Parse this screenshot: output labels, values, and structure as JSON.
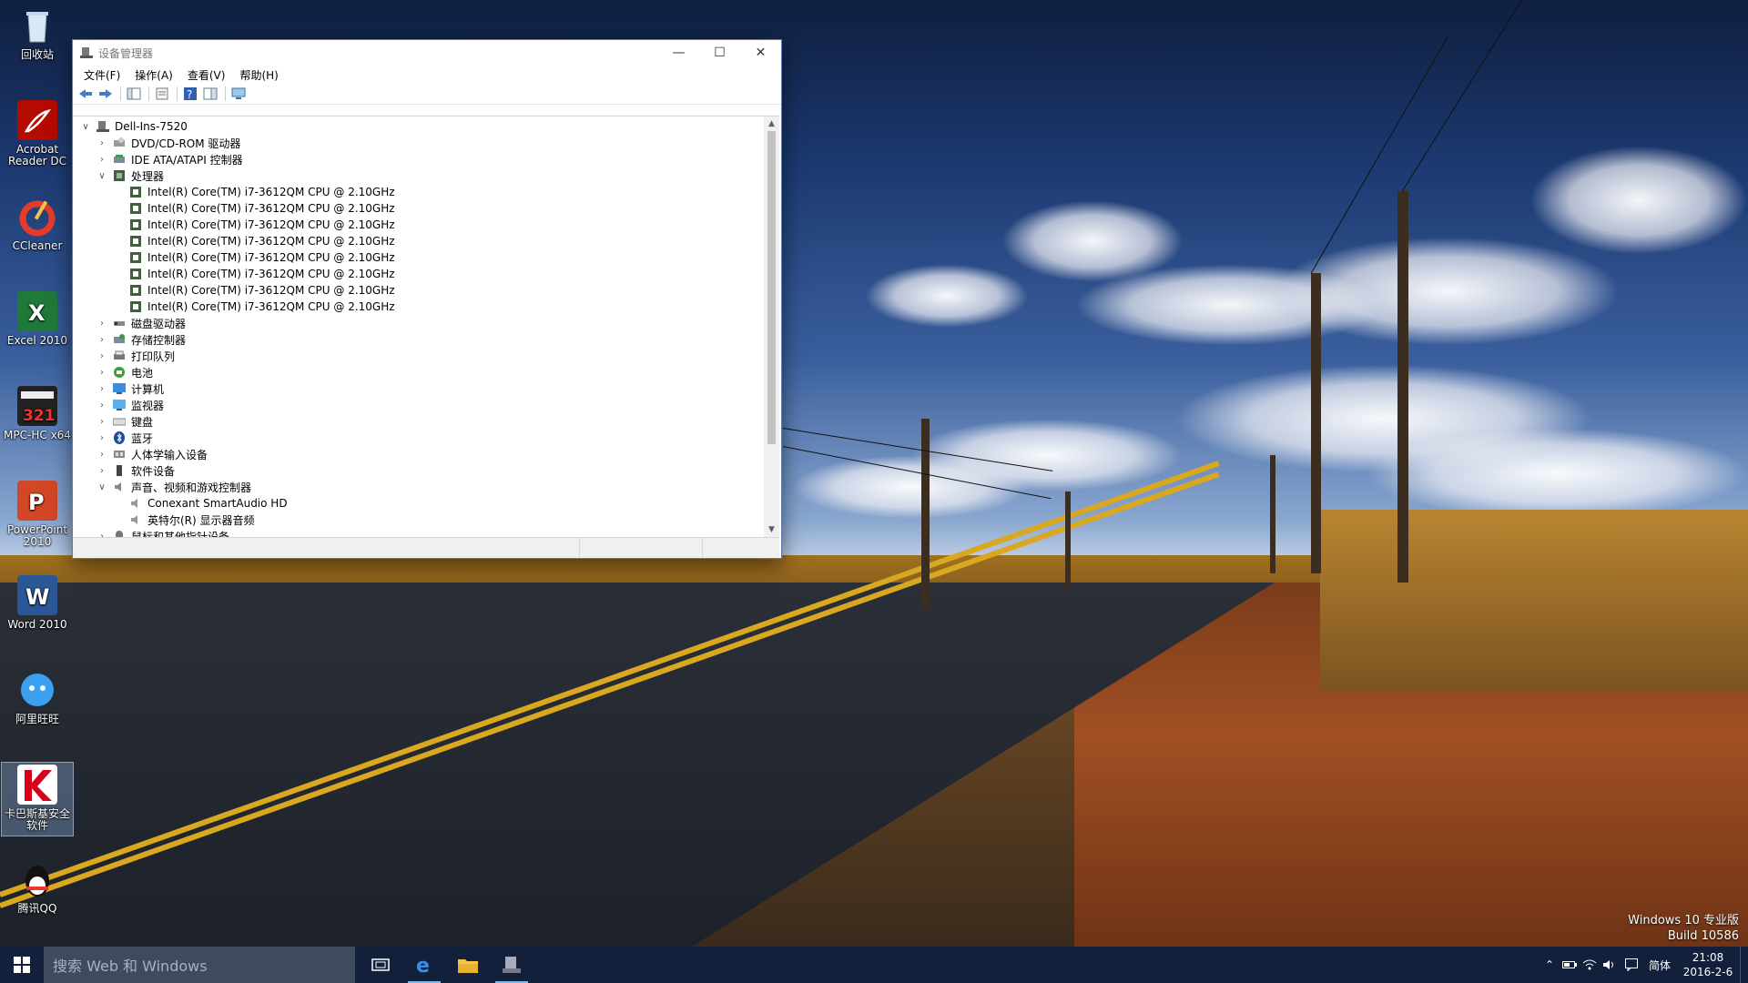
{
  "desktop": {
    "icons": [
      {
        "label": "回收站",
        "name": "recycle-bin"
      },
      {
        "label": "Acrobat Reader DC",
        "name": "acrobat-reader"
      },
      {
        "label": "CCleaner",
        "name": "ccleaner"
      },
      {
        "label": "Excel 2010",
        "name": "excel-2010"
      },
      {
        "label": "MPC-HC x64",
        "name": "mpc-hc"
      },
      {
        "label": "PowerPoint 2010",
        "name": "powerpoint-2010"
      },
      {
        "label": "Word 2010",
        "name": "word-2010"
      },
      {
        "label": "阿里旺旺",
        "name": "aliwangwang"
      },
      {
        "label": "卡巴斯基安全软件",
        "name": "kaspersky"
      },
      {
        "label": "腾讯QQ",
        "name": "tencent-qq"
      }
    ],
    "watermark_line1": "Windows 10 专业版",
    "watermark_line2": "Build 10586"
  },
  "window": {
    "title": "设备管理器",
    "menu": [
      "文件(F)",
      "操作(A)",
      "查看(V)",
      "帮助(H)"
    ],
    "tree": {
      "root": "Dell-Ins-7520",
      "nodes": [
        {
          "label": "DVD/CD-ROM 驱动器",
          "icon": "dvd-drive-icon",
          "expanded": false
        },
        {
          "label": "IDE ATA/ATAPI 控制器",
          "icon": "ide-controller-icon",
          "expanded": false
        },
        {
          "label": "处理器",
          "icon": "processor-icon",
          "expanded": true
        },
        {
          "label": "磁盘驱动器",
          "icon": "disk-drive-icon",
          "expanded": false
        },
        {
          "label": "存储控制器",
          "icon": "storage-controller-icon",
          "expanded": false
        },
        {
          "label": "打印队列",
          "icon": "printer-icon",
          "expanded": false
        },
        {
          "label": "电池",
          "icon": "battery-icon",
          "expanded": false
        },
        {
          "label": "计算机",
          "icon": "computer-icon",
          "expanded": false
        },
        {
          "label": "监视器",
          "icon": "monitor-icon",
          "expanded": false
        },
        {
          "label": "键盘",
          "icon": "keyboard-icon",
          "expanded": false
        },
        {
          "label": "蓝牙",
          "icon": "bluetooth-icon",
          "expanded": false
        },
        {
          "label": "人体学输入设备",
          "icon": "hid-icon",
          "expanded": false
        },
        {
          "label": "软件设备",
          "icon": "software-device-icon",
          "expanded": false
        },
        {
          "label": "声音、视频和游戏控制器",
          "icon": "sound-icon",
          "expanded": true
        },
        {
          "label": "鼠标和其他指针设备",
          "icon": "mouse-icon",
          "expanded": false
        }
      ],
      "processors": [
        "Intel(R) Core(TM) i7-3612QM CPU @ 2.10GHz",
        "Intel(R) Core(TM) i7-3612QM CPU @ 2.10GHz",
        "Intel(R) Core(TM) i7-3612QM CPU @ 2.10GHz",
        "Intel(R) Core(TM) i7-3612QM CPU @ 2.10GHz",
        "Intel(R) Core(TM) i7-3612QM CPU @ 2.10GHz",
        "Intel(R) Core(TM) i7-3612QM CPU @ 2.10GHz",
        "Intel(R) Core(TM) i7-3612QM CPU @ 2.10GHz",
        "Intel(R) Core(TM) i7-3612QM CPU @ 2.10GHz"
      ],
      "sound_devices": [
        "Conexant SmartAudio HD",
        "英特尔(R) 显示器音频"
      ]
    }
  },
  "taskbar": {
    "search_placeholder": "搜索 Web 和 Windows",
    "ime": "简体",
    "time": "21:08",
    "date": "2016-2-6"
  },
  "colors": {
    "taskbar": "#13203b",
    "search": "#3e4a5e",
    "accent": "#76b9ed"
  }
}
